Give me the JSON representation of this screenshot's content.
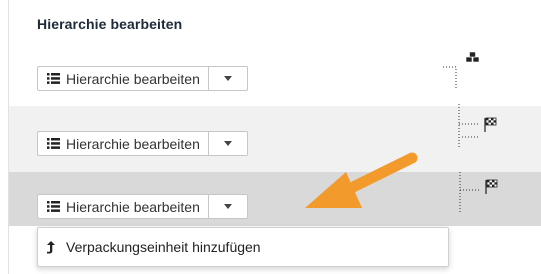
{
  "section": {
    "title": "Hierarchie bearbeiten"
  },
  "rows": [
    {
      "button_label": "Hierarchie bearbeiten"
    },
    {
      "button_label": "Hierarchie bearbeiten"
    },
    {
      "button_label": "Hierarchie bearbeiten"
    }
  ],
  "dropdown": {
    "items": [
      {
        "label": "Verpackungseinheit hinzufügen",
        "icon": "arrow-up-turn-icon"
      }
    ]
  },
  "icons": {
    "list": "list-icon",
    "caret": "chevron-down-icon",
    "root_node": "boxes-icon",
    "leaf_node": "checkered-flag-icon"
  },
  "colors": {
    "highlight_row": "#d9d9d9",
    "alt_row": "#f1f1f1",
    "callout_arrow": "#f39a2c"
  }
}
